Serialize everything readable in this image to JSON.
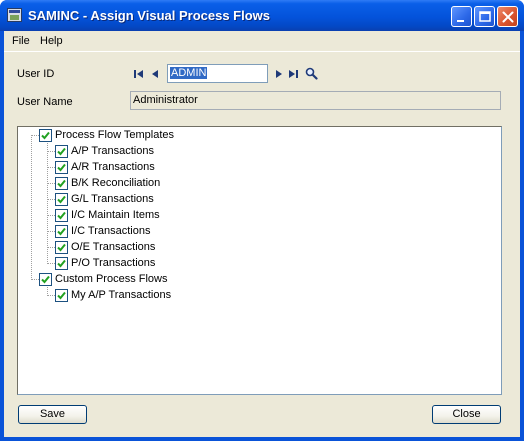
{
  "window": {
    "title": "SAMINC - Assign Visual Process Flows"
  },
  "menu": {
    "file": "File",
    "help": "Help"
  },
  "form": {
    "user_id_label": "User ID",
    "user_id_value": "ADMIN",
    "user_name_label": "User Name",
    "user_name_value": "Administrator"
  },
  "tree": {
    "groups": [
      {
        "label": "Process Flow Templates",
        "checked": true,
        "items": [
          {
            "label": "A/P Transactions",
            "checked": true
          },
          {
            "label": "A/R Transactions",
            "checked": true
          },
          {
            "label": "B/K Reconciliation",
            "checked": true
          },
          {
            "label": "G/L Transactions",
            "checked": true
          },
          {
            "label": "I/C Maintain Items",
            "checked": true
          },
          {
            "label": "I/C Transactions",
            "checked": true
          },
          {
            "label": "O/E Transactions",
            "checked": true
          },
          {
            "label": "P/O Transactions",
            "checked": true
          }
        ]
      },
      {
        "label": "Custom Process Flows",
        "checked": true,
        "items": [
          {
            "label": "My A/P Transactions",
            "checked": true
          }
        ]
      }
    ]
  },
  "buttons": {
    "save": "Save",
    "close": "Close"
  },
  "icons": {
    "nav_first": "first-record-icon",
    "nav_prev": "previous-record-icon",
    "nav_next": "next-record-icon",
    "nav_last": "last-record-icon",
    "finder": "magnifier-icon"
  }
}
